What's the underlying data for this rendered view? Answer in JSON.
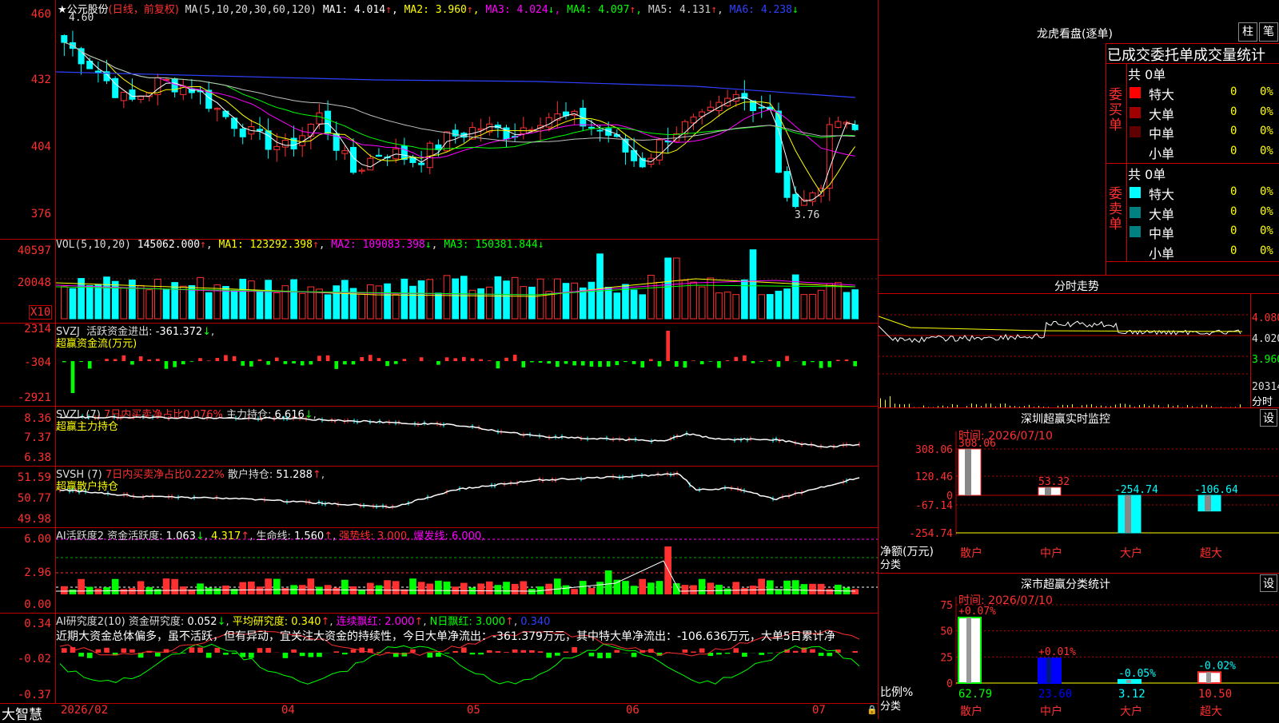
{
  "chart_data": [
    {
      "type": "candlestick",
      "title": "★公元股份",
      "subtitle": "(日线，前复权)",
      "ma_label": "MA(5,10,20,30,60,120)",
      "ma": [
        {
          "name": "MA1",
          "value": "4.014",
          "color": "#ffffff"
        },
        {
          "name": "MA2",
          "value": "3.960",
          "color": "#ffff00"
        },
        {
          "name": "MA3",
          "value": "4.024",
          "color": "#ff00ff"
        },
        {
          "name": "MA4",
          "value": "4.097",
          "color": "#00ff00"
        },
        {
          "name": "MA5",
          "value": "4.131",
          "color": "#c0c0c0"
        },
        {
          "name": "MA6",
          "value": "4.238",
          "color": "#3040ff"
        }
      ],
      "y_ticks": [
        "460",
        "432",
        "404",
        "376"
      ],
      "high_label": "4.60",
      "low_label": "3.76"
    },
    {
      "type": "bar",
      "title": "VOL(5,10,20)",
      "value": "145062.000",
      "ma": [
        {
          "name": "MA1",
          "value": "123292.398"
        },
        {
          "name": "MA2",
          "value": "109083.398"
        },
        {
          "name": "MA3",
          "value": "150381.844"
        }
      ],
      "y_ticks": [
        "40597",
        "20048"
      ],
      "unit": "X10"
    },
    {
      "type": "bar",
      "title": "SVZJ",
      "label": "活跃资金进出",
      "value": "-361.372",
      "sub": "超赢资金流(万元)",
      "y_ticks": [
        "2314",
        "-304",
        "-2921"
      ]
    },
    {
      "type": "line",
      "title": "SVZL (7)",
      "label": "7日内买卖净占比",
      "ratio": "0.076%",
      "label2": "主力持仓",
      "value": "6.616",
      "sub": "超赢主力持仓",
      "y_ticks": [
        "8.36",
        "7.37",
        "6.38"
      ]
    },
    {
      "type": "line",
      "title": "SVSH (7)",
      "label": "7日内买卖净占比",
      "ratio": "0.222%",
      "label2": "散户持仓",
      "value": "51.288",
      "sub": "超赢散户持仓",
      "y_ticks": [
        "51.59",
        "50.77",
        "49.98"
      ]
    },
    {
      "type": "bar",
      "title": "AI活跃度2",
      "label": "资金活跃度",
      "value": "1.063",
      "v2": "4.317",
      "life_label": "生命线",
      "life": "1.560",
      "strong_label": "强势线",
      "strong": "3.000",
      "burst_label": "爆发线",
      "burst": "6.000",
      "y_ticks": [
        "6.00",
        "2.96",
        "0.00"
      ]
    },
    {
      "type": "bar",
      "title": "AI研究度2(10)",
      "label": "资金研究度",
      "value": "0.052",
      "avg_label": "平均研究度",
      "avg": "0.340",
      "red_label": "连续飘红",
      "red": "2.000",
      "n_label": "N日飘红",
      "n": "3.000",
      "v4": "0.340",
      "comment": "近期大资金总体偏多，虽不活跃，但有异动，宜关注大资金的持续性，今日大单净流出：-361.379万元，其中特大单净流出：-106.636万元，大单5日累计净",
      "y_ticks": [
        "0.34",
        "-0.02",
        "-0.37"
      ]
    }
  ],
  "x_axis": {
    "brand": "大智慧",
    "labels": [
      "2026/02",
      "04",
      "05",
      "06",
      "07"
    ]
  },
  "right": {
    "dragon": {
      "title": "龙虎看盘(逐单)",
      "btn1": "柱",
      "btn2": "笔",
      "subtitle": "已成交委托单成交量统计",
      "buy": {
        "side": "委买单",
        "total": "共 0单",
        "rows": [
          {
            "name": "特大",
            "n": "0",
            "p": "0%",
            "color": "#ff0000"
          },
          {
            "name": "大单",
            "n": "0",
            "p": "0%",
            "color": "#a00000"
          },
          {
            "name": "中单",
            "n": "0",
            "p": "0%",
            "color": "#600000"
          },
          {
            "name": "小单",
            "n": "0",
            "p": "0%",
            "color": "#000000"
          }
        ]
      },
      "sell": {
        "side": "委卖单",
        "total": "共 0单",
        "rows": [
          {
            "name": "特大",
            "n": "0",
            "p": "0%",
            "color": "#00ffff"
          },
          {
            "name": "大单",
            "n": "0",
            "p": "0%",
            "color": "#008080"
          },
          {
            "name": "中单",
            "n": "0",
            "p": "0%",
            "color": "#008080"
          },
          {
            "name": "小单",
            "n": "0",
            "p": "0%",
            "color": "#000000"
          }
        ]
      }
    },
    "intraday": {
      "title": "分时走势",
      "ticks": [
        "4.080",
        "4.020",
        "3.960"
      ],
      "vol": "20314",
      "tag": "分时"
    },
    "monitor": {
      "title": "深圳超赢实时监控",
      "btn": "设",
      "time": "时间: 2026/07/10",
      "y_ticks": [
        "308.06",
        "120.46",
        "0",
        "-67.14",
        "-254.74"
      ],
      "footer1": "净额(万元)",
      "footer2": "分类",
      "bars": [
        {
          "name": "散户",
          "value": 308.06,
          "label": "308.06"
        },
        {
          "name": "中户",
          "value": 53.32,
          "label": "53.32"
        },
        {
          "name": "大户",
          "value": -254.74,
          "label": "-254.74"
        },
        {
          "name": "超大",
          "value": -106.64,
          "label": "-106.64"
        }
      ]
    },
    "classify": {
      "title": "深市超赢分类统计",
      "btn": "设",
      "time": "时间: 2026/07/10",
      "y_ticks": [
        "75",
        "50",
        "25",
        "0"
      ],
      "footer1": "比例%",
      "footer2": "分类",
      "bars": [
        {
          "name": "散户",
          "value": 62.79,
          "label": "62.79",
          "delta": "+0.07%"
        },
        {
          "name": "中户",
          "value": 23.6,
          "label": "23.60",
          "delta": "+0.01%"
        },
        {
          "name": "大户",
          "value": 3.12,
          "label": "3.12",
          "delta": "-0.05%"
        },
        {
          "name": "超大",
          "value": 10.5,
          "label": "10.50",
          "delta": "-0.02%"
        }
      ]
    }
  }
}
